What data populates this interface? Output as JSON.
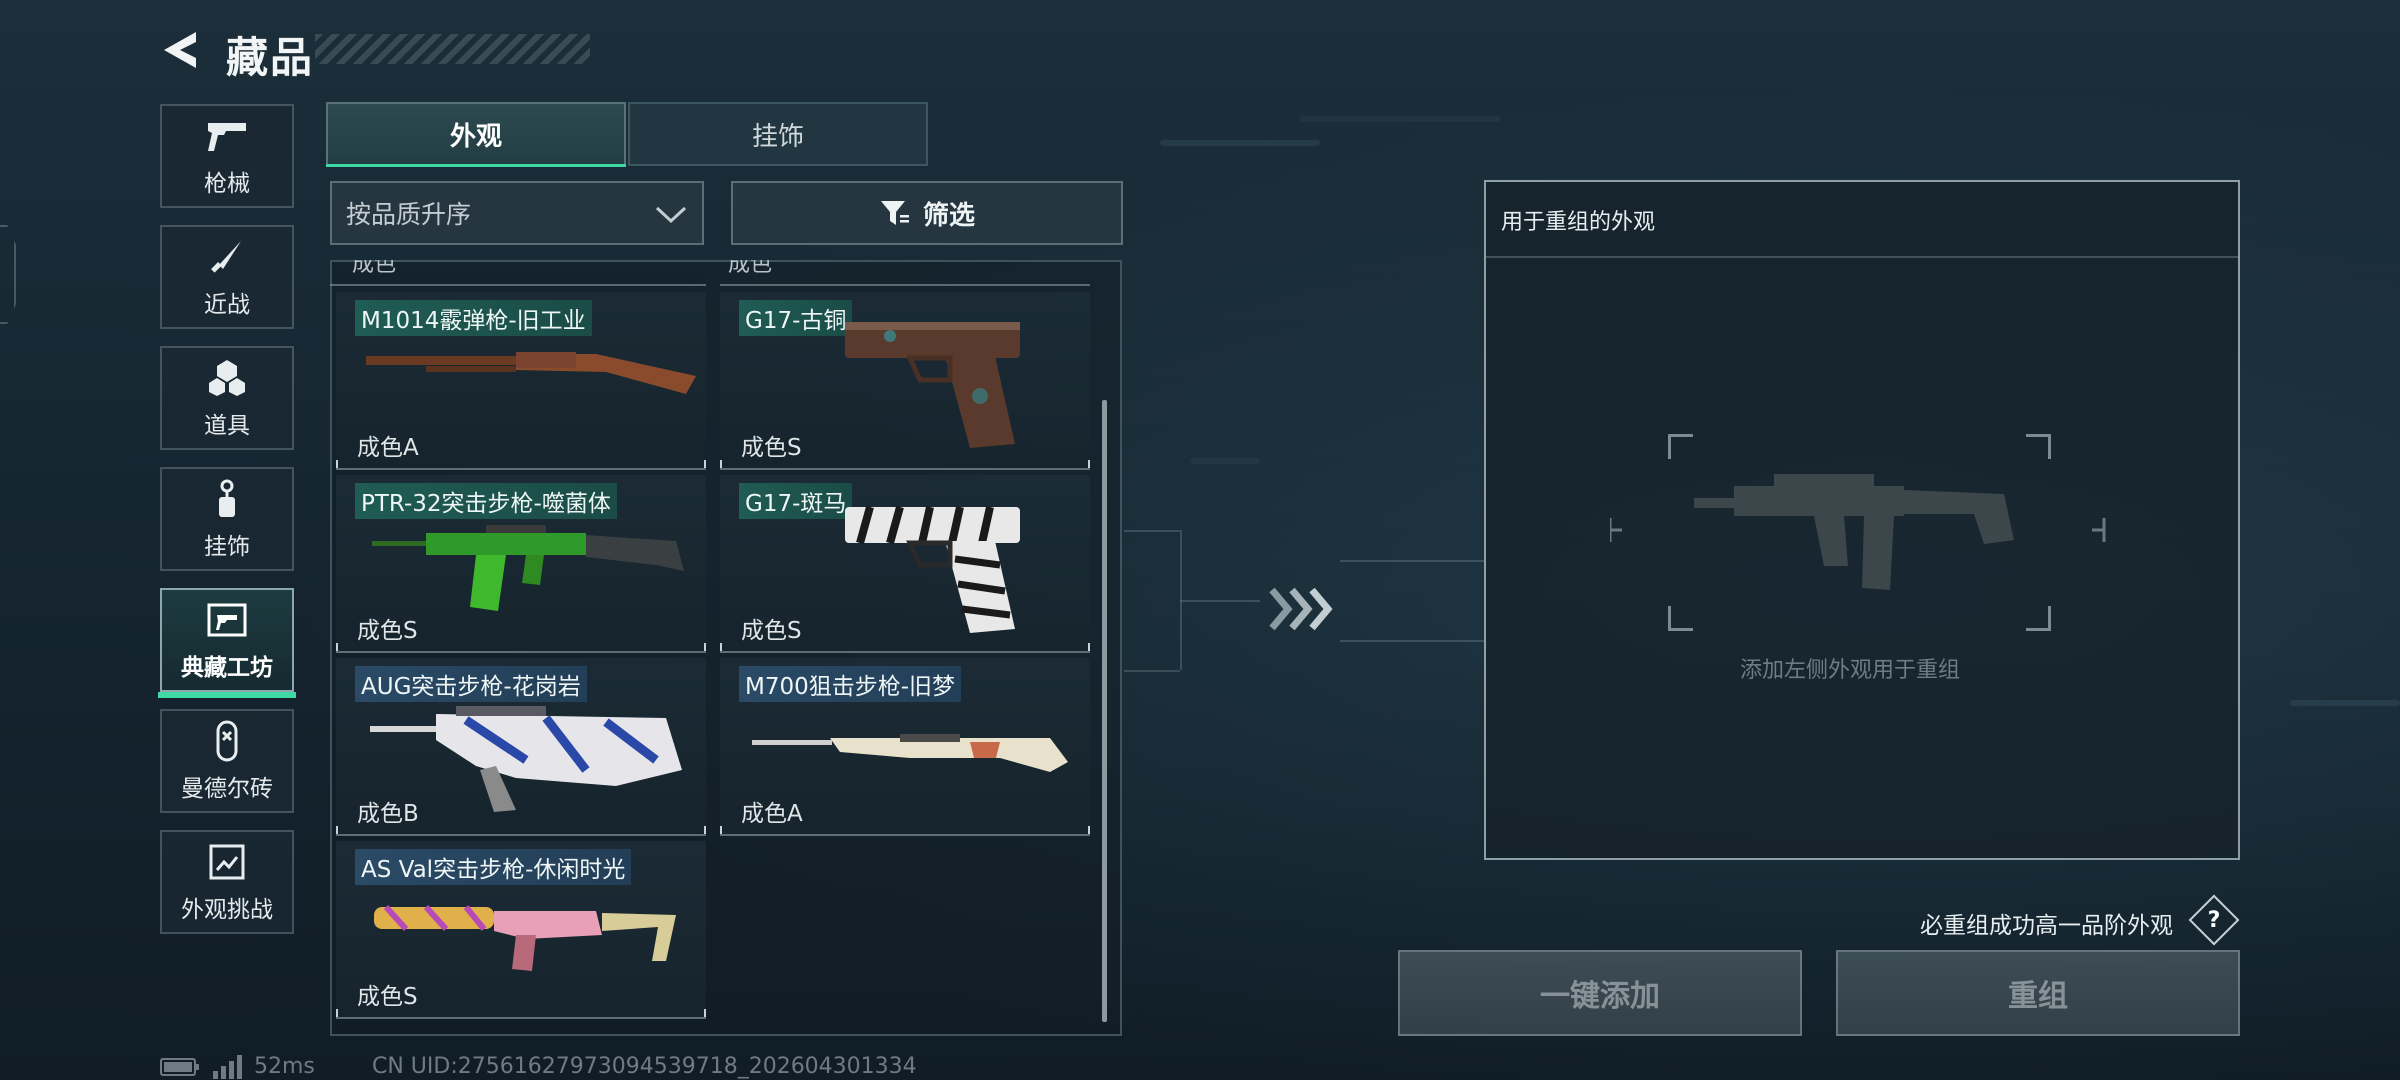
{
  "header": {
    "title": "藏品"
  },
  "categories": [
    {
      "label": "枪械",
      "icon": "pistol-icon"
    },
    {
      "label": "近战",
      "icon": "knife-icon"
    },
    {
      "label": "道具",
      "icon": "items-icon"
    },
    {
      "label": "挂饰",
      "icon": "pendant-icon"
    },
    {
      "label": "典藏工坊",
      "icon": "workshop-icon",
      "active": true
    },
    {
      "label": "曼德尔砖",
      "icon": "brick-icon"
    },
    {
      "label": "外观挑战",
      "icon": "challenge-icon"
    }
  ],
  "tabs": [
    {
      "label": "外观",
      "active": true
    },
    {
      "label": "挂饰",
      "active": false
    }
  ],
  "sort": {
    "value": "按品质升序"
  },
  "filter": {
    "label": "筛选"
  },
  "items": [
    {
      "name": "M1014霰弹枪-旧工业",
      "grade": "成色A",
      "tag_color": "green"
    },
    {
      "name": "G17-古铜",
      "grade": "成色S",
      "tag_color": "green"
    },
    {
      "name": "PTR-32突击步枪-噬菌体",
      "grade": "成色S",
      "tag_color": "green"
    },
    {
      "name": "G17-斑马",
      "grade": "成色S",
      "tag_color": "green"
    },
    {
      "name": "AUG突击步枪-花岗岩",
      "grade": "成色B",
      "tag_color": "blue"
    },
    {
      "name": "M700狙击步枪-旧梦",
      "grade": "成色A",
      "tag_color": "blue"
    },
    {
      "name": "AS Val突击步枪-休闲时光",
      "grade": "成色S",
      "tag_color": "blue"
    }
  ],
  "panel": {
    "title": "用于重组的外观",
    "hint": "添加左侧外观用于重组"
  },
  "guarantee": {
    "text": "必重组成功高一品阶外观",
    "help_label": "?"
  },
  "buttons": {
    "add_all": "一键添加",
    "reforge": "重组"
  },
  "status": {
    "latency": "52ms",
    "uid": "CN UID:27561627973094539718_202604301334"
  },
  "colors": {
    "accent": "#3fd9a6",
    "tag_green": "#1f5c54",
    "tag_blue": "#2a4a66"
  }
}
